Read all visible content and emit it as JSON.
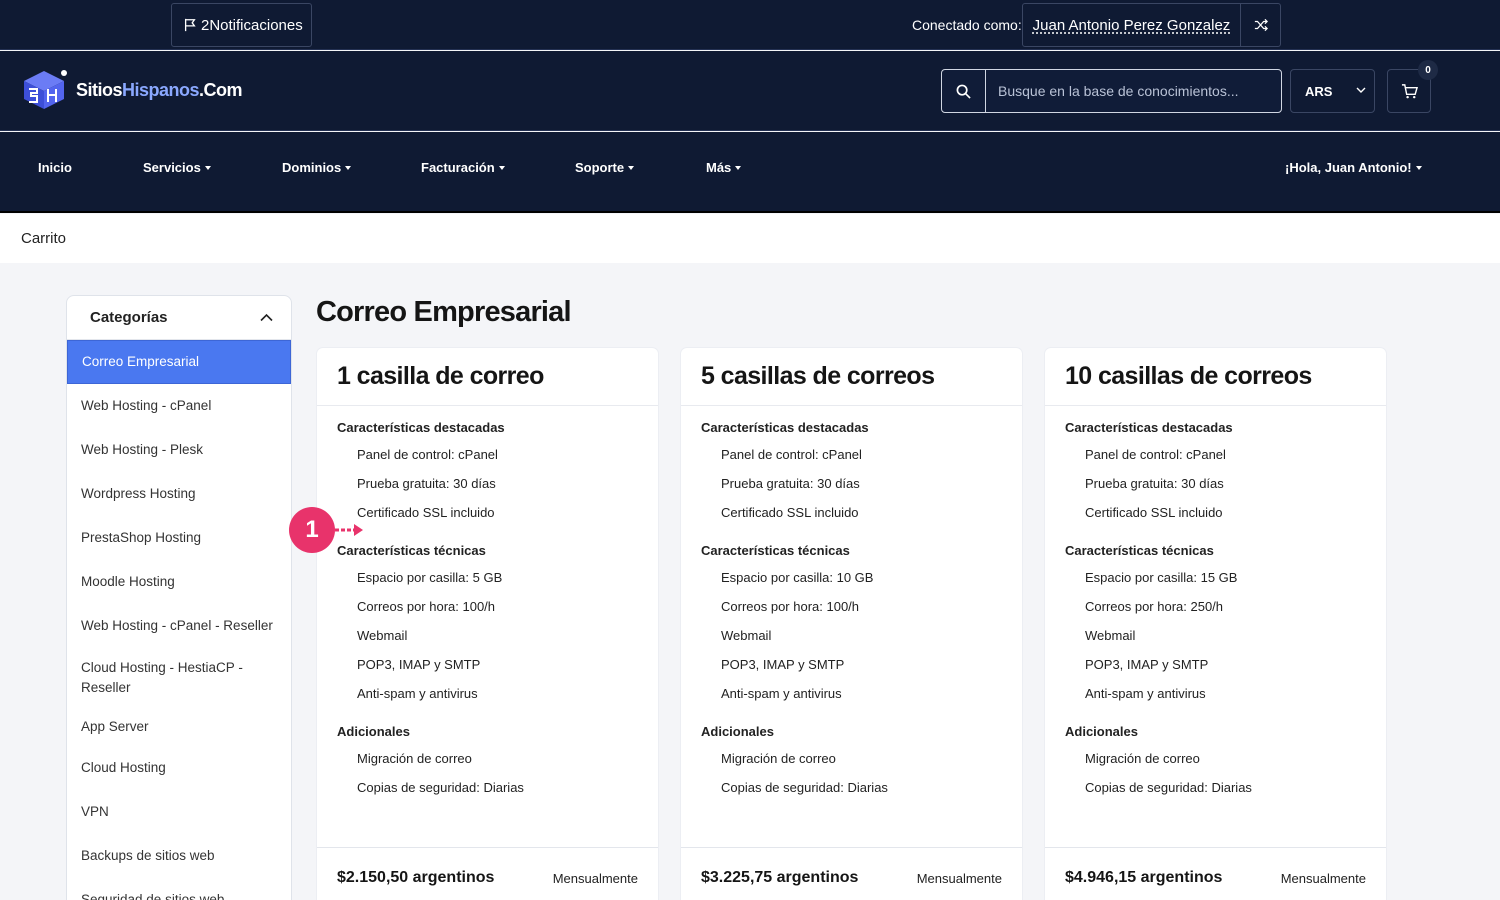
{
  "topbar": {
    "notifications_label": "2Notificaciones",
    "connected_label": "Conectado como:",
    "user_name": "Juan Antonio Perez Gonzalez"
  },
  "header": {
    "logo_part1": "Sitios",
    "logo_part2": "Hispanos",
    "logo_part3": ".Com",
    "search_placeholder": "Busque en la base de conocimientos...",
    "currency": "ARS",
    "cart_count": "0"
  },
  "nav": {
    "items": [
      {
        "label": "Inicio"
      },
      {
        "label": "Servicios"
      },
      {
        "label": "Dominios"
      },
      {
        "label": "Facturación"
      },
      {
        "label": "Soporte"
      },
      {
        "label": "Más"
      }
    ],
    "greeting": "¡Hola, Juan Antonio!"
  },
  "breadcrumb": "Carrito",
  "sidebar": {
    "title": "Categorías",
    "items": [
      {
        "label": "Correo Empresarial"
      },
      {
        "label": "Web Hosting - cPanel"
      },
      {
        "label": "Web Hosting - Plesk"
      },
      {
        "label": "Wordpress Hosting"
      },
      {
        "label": "PrestaShop Hosting"
      },
      {
        "label": "Moodle Hosting"
      },
      {
        "label": "Web Hosting - cPanel - Reseller"
      },
      {
        "label": "Cloud Hosting - HestiaCP - Reseller"
      },
      {
        "label": "App Server"
      },
      {
        "label": "Cloud Hosting"
      },
      {
        "label": "VPN"
      },
      {
        "label": "Backups de sitios web"
      },
      {
        "label": "Seguridad de sitios web"
      }
    ]
  },
  "main": {
    "title": "Correo Empresarial",
    "products": [
      {
        "name": "1 casilla de correo",
        "highlight_head": "Características destacadas",
        "highlights": [
          "Panel de control: cPanel",
          "Prueba gratuita: 30 días",
          "Certificado SSL incluido"
        ],
        "tech_head": "Características técnicas",
        "tech": [
          "Espacio por casilla: 5 GB",
          "Correos por hora: 100/h",
          "Webmail",
          "POP3, IMAP y SMTP",
          "Anti-spam y antivirus"
        ],
        "extra_head": "Adicionales",
        "extras": [
          "Migración de correo",
          "Copias de seguridad: Diarias"
        ],
        "price": "$2.150,50 argentinos",
        "cycle": "Mensualmente"
      },
      {
        "name": "5 casillas de correos",
        "highlight_head": "Características destacadas",
        "highlights": [
          "Panel de control: cPanel",
          "Prueba gratuita: 30 días",
          "Certificado SSL incluido"
        ],
        "tech_head": "Características técnicas",
        "tech": [
          "Espacio por casilla: 10 GB",
          "Correos por hora: 100/h",
          "Webmail",
          "POP3, IMAP y SMTP",
          "Anti-spam y antivirus"
        ],
        "extra_head": "Adicionales",
        "extras": [
          "Migración de correo",
          "Copias de seguridad: Diarias"
        ],
        "price": "$3.225,75 argentinos",
        "cycle": "Mensualmente"
      },
      {
        "name": "10 casillas de correos",
        "highlight_head": "Características destacadas",
        "highlights": [
          "Panel de control: cPanel",
          "Prueba gratuita: 30 días",
          "Certificado SSL incluido"
        ],
        "tech_head": "Características técnicas",
        "tech": [
          "Espacio por casilla: 15 GB",
          "Correos por hora: 250/h",
          "Webmail",
          "POP3, IMAP y SMTP",
          "Anti-spam y antivirus"
        ],
        "extra_head": "Adicionales",
        "extras": [
          "Migración de correo",
          "Copias de seguridad: Diarias"
        ],
        "price": "$4.946,15 argentinos",
        "cycle": "Mensualmente"
      }
    ]
  },
  "annotation": {
    "marker": "1"
  },
  "colors": {
    "header_bg": "#0f1a33",
    "accent": "#4a78f0",
    "marker": "#e8336b"
  }
}
